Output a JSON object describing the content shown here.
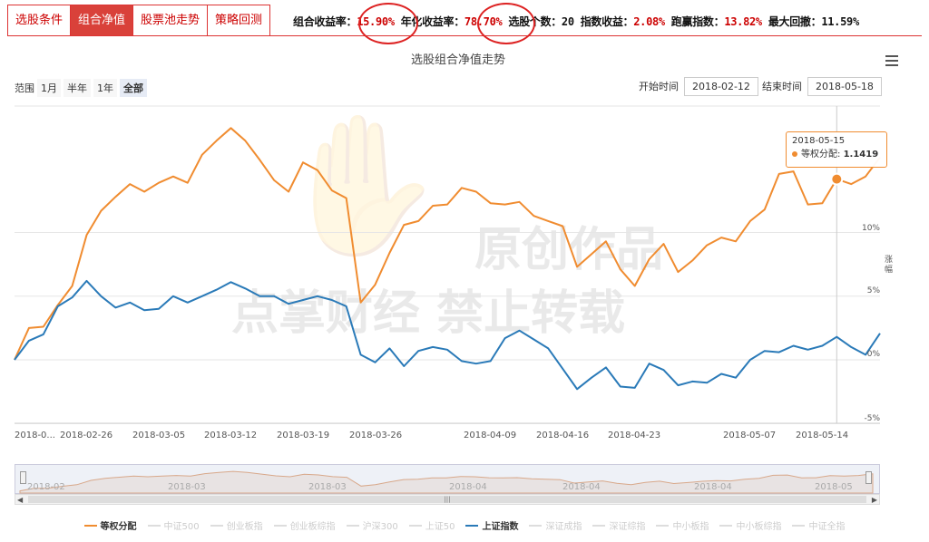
{
  "tabs": [
    {
      "label": "选股条件"
    },
    {
      "label": "组合净值"
    },
    {
      "label": "股票池走势"
    },
    {
      "label": "策略回测"
    }
  ],
  "stats": {
    "portfolio_return_label": "组合收益率：",
    "portfolio_return": "15.90%",
    "annual_return_label": "年化收益率：",
    "annual_return": "78.70%",
    "stock_count_label": "选股个数：",
    "stock_count": "20",
    "index_return_label": "指数收益：",
    "index_return": "2.08%",
    "excess_label": "跑赢指数：",
    "excess": "13.82%",
    "max_drawdown_label": "最大回撤：",
    "max_drawdown": "11.59%"
  },
  "chart_title": "选股组合净值走势",
  "range": {
    "label": "范围",
    "buttons": [
      "1月",
      "半年",
      "1年",
      "全部"
    ],
    "selected": "全部"
  },
  "date_range": {
    "start_label": "开始时间",
    "start": "2018-02-12",
    "end_label": "结束时间",
    "end": "2018-05-18"
  },
  "y_unit": "涨幅",
  "watermark": {
    "line1": "原创作品",
    "line2": "点掌财经 禁止转载"
  },
  "tooltip": {
    "date": "2018-05-15",
    "series": "等权分配",
    "value": "1.1419"
  },
  "navigator_labels": [
    "2018-02",
    "2018-03",
    "2018-03",
    "2018-04",
    "2018-04",
    "2018-04",
    "2018-05"
  ],
  "legend": [
    {
      "name": "等权分配",
      "active": true,
      "color": "#f08c30"
    },
    {
      "name": "中证500",
      "active": false
    },
    {
      "name": "创业板指",
      "active": false
    },
    {
      "name": "创业板综指",
      "active": false
    },
    {
      "name": "沪深300",
      "active": false
    },
    {
      "name": "上证50",
      "active": false
    },
    {
      "name": "上证指数",
      "active": true,
      "color": "#2a7ab8"
    },
    {
      "name": "深证成指",
      "active": false
    },
    {
      "name": "深证综指",
      "active": false
    },
    {
      "name": "中小板指",
      "active": false
    },
    {
      "name": "中小板综指",
      "active": false
    },
    {
      "name": "中证全指",
      "active": false
    }
  ],
  "chart_data": {
    "type": "line",
    "x": [
      "2018-02-12",
      "2018-02-13",
      "2018-02-14",
      "2018-02-22",
      "2018-02-23",
      "2018-02-26",
      "2018-02-27",
      "2018-02-28",
      "2018-03-01",
      "2018-03-02",
      "2018-03-05",
      "2018-03-06",
      "2018-03-07",
      "2018-03-08",
      "2018-03-09",
      "2018-03-12",
      "2018-03-13",
      "2018-03-14",
      "2018-03-15",
      "2018-03-16",
      "2018-03-19",
      "2018-03-20",
      "2018-03-21",
      "2018-03-22",
      "2018-03-23",
      "2018-03-26",
      "2018-03-27",
      "2018-03-28",
      "2018-03-29",
      "2018-03-30",
      "2018-04-02",
      "2018-04-03",
      "2018-04-04",
      "2018-04-09",
      "2018-04-10",
      "2018-04-11",
      "2018-04-12",
      "2018-04-13",
      "2018-04-16",
      "2018-04-17",
      "2018-04-18",
      "2018-04-19",
      "2018-04-20",
      "2018-04-23",
      "2018-04-24",
      "2018-04-25",
      "2018-04-26",
      "2018-04-27",
      "2018-05-02",
      "2018-05-03",
      "2018-05-04",
      "2018-05-07",
      "2018-05-08",
      "2018-05-09",
      "2018-05-10",
      "2018-05-11",
      "2018-05-14",
      "2018-05-15",
      "2018-05-16",
      "2018-05-17",
      "2018-05-18"
    ],
    "series": [
      {
        "name": "等权分配",
        "color": "#f08c30",
        "values": [
          0,
          2.5,
          2.6,
          4.3,
          5.8,
          9.8,
          11.7,
          12.8,
          13.8,
          13.2,
          13.9,
          14.4,
          13.9,
          16.1,
          17.2,
          18.2,
          17.2,
          15.7,
          14.1,
          13.2,
          15.5,
          14.9,
          13.3,
          12.7,
          4.5,
          5.9,
          8.4,
          10.6,
          10.9,
          12.1,
          12.2,
          13.5,
          13.2,
          12.3,
          12.2,
          12.4,
          11.3,
          10.9,
          10.5,
          7.3,
          8.3,
          9.3,
          7.1,
          5.8,
          7.9,
          9.1,
          6.9,
          7.8,
          9.0,
          9.6,
          9.3,
          10.9,
          11.8,
          14.6,
          14.8,
          12.2,
          12.3,
          14.19,
          13.8,
          14.4,
          15.9
        ]
      },
      {
        "name": "上证指数",
        "color": "#2a7ab8",
        "values": [
          0,
          1.5,
          2.0,
          4.2,
          4.9,
          6.2,
          5.0,
          4.1,
          4.5,
          3.9,
          4.0,
          5.0,
          4.5,
          5.0,
          5.5,
          6.1,
          5.6,
          5.0,
          5.0,
          4.4,
          4.7,
          5.0,
          4.7,
          4.2,
          0.4,
          -0.2,
          0.9,
          -0.5,
          0.7,
          1.0,
          0.8,
          -0.1,
          -0.3,
          -0.1,
          1.7,
          2.3,
          1.6,
          0.9,
          -0.7,
          -2.3,
          -1.4,
          -0.6,
          -2.1,
          -2.2,
          -0.3,
          -0.8,
          -2.0,
          -1.7,
          -1.8,
          -1.1,
          -1.4,
          0.0,
          0.7,
          0.6,
          1.1,
          0.8,
          1.1,
          1.8,
          1.0,
          0.4,
          2.08
        ]
      }
    ],
    "ylim": [
      -5,
      20
    ],
    "yticks": [
      -5,
      0,
      5,
      10
    ],
    "ytick_labels": [
      "-5%",
      "0%",
      "5%",
      "10%"
    ],
    "xtick_labels": [
      "2018-0...",
      "2018-02-26",
      "2018-03-05",
      "2018-03-12",
      "2018-03-19",
      "2018-03-26",
      "2018-04-09",
      "2018-04-16",
      "2018-04-23",
      "2018-05-07",
      "2018-05-14"
    ],
    "ylabel": "涨幅",
    "grid": true
  }
}
